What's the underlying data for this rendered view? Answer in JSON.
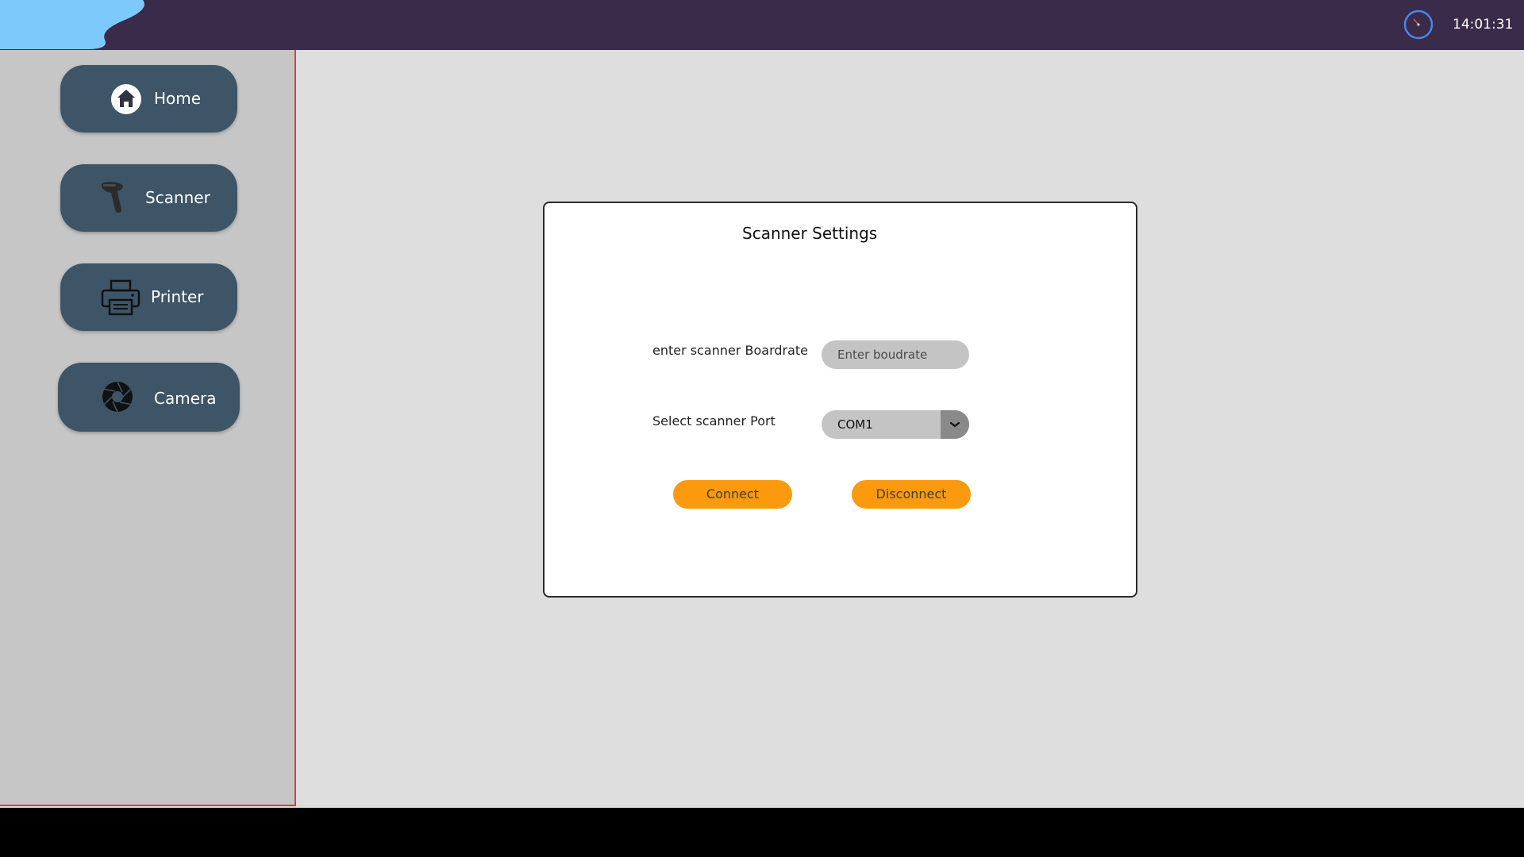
{
  "header": {
    "time": "14:01:31",
    "clock_icon": "clock-icon",
    "logo_color": "#7ec9fb",
    "bar_color": "#3a2b4a"
  },
  "sidebar": {
    "items": [
      {
        "label": "Home",
        "icon": "home-icon"
      },
      {
        "label": "Scanner",
        "icon": "barcode-scanner-icon"
      },
      {
        "label": "Printer",
        "icon": "printer-icon"
      },
      {
        "label": "Camera",
        "icon": "camera-aperture-icon"
      }
    ],
    "button_color": "#3e5568"
  },
  "panel": {
    "title": "Scanner Settings",
    "baud_label": "enter scanner Boardrate",
    "baud_placeholder": "Enter boudrate",
    "port_label": "Select scanner Port",
    "port_value": "COM1",
    "connect_label": "Connect",
    "disconnect_label": "Disconnect",
    "accent_color": "#fb9a0e"
  }
}
